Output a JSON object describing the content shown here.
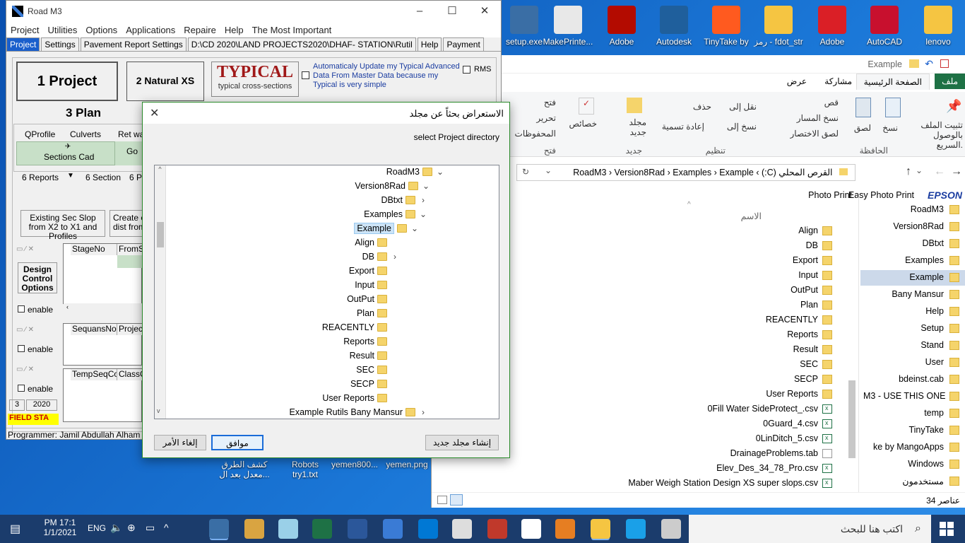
{
  "desktop_icons": [
    {
      "label": "setup.exe",
      "color": "#3a6ea5"
    },
    {
      "label": "MakePrinte...",
      "color": "#e8e8e8"
    },
    {
      "label": "Adobe",
      "color": "#b30b00"
    },
    {
      "label": "Autodesk",
      "color": "#1f5f9c"
    },
    {
      "label": "TinyTake by",
      "color": "#ff5a1f"
    },
    {
      "label": "رمز - fdot_str",
      "color": "#f5c542"
    },
    {
      "label": "Adobe",
      "color": "#da1f26"
    },
    {
      "label": "AutoCAD",
      "color": "#c8102e"
    },
    {
      "label": "lenovo",
      "color": "#f5c542"
    }
  ],
  "desktop_bottom_icons": [
    {
      "label1": "كشف الطرق",
      "label2": "معدل بعد ال..."
    },
    {
      "label1": "Robots",
      "label2": "try1.txt"
    },
    {
      "label1": "yemen800...",
      "label2": ""
    },
    {
      "label1": "yemen.png",
      "label2": ""
    }
  ],
  "road": {
    "title": "Road M3",
    "menu": [
      "Project",
      "Utilities",
      "Options",
      "Applications",
      "Repaire",
      "Help",
      "The Most Important"
    ],
    "tabs": [
      "Project",
      "Settings",
      "Pavement Report Settings",
      "D:\\CD 2020\\LAND PROJECTS2020\\DHAF- STATION\\Rutil",
      "Help",
      "Payment"
    ],
    "btn_project": "1 Project",
    "btn_natural": "2 Natural XS",
    "typical_big": "TYPICAL",
    "typical_small": "typical cross-sections",
    "auto_update": "Automaticaly Update my Typical Advanced Data From Master Data because my Typical is very simple",
    "rms": "RMS",
    "plan": "3 Plan",
    "qprofile": "QProfile",
    "culverts": "Culverts",
    "retwa": "Ret wa",
    "sections_cad": "Sections Cad",
    "go": "Go",
    "reports": "6 Reports",
    "section": "6 Section",
    "sixp": "6 Pl",
    "existing": "Existing Sec Slop from X2 to X1 and Profiles",
    "create": "Create e dist from",
    "design_control": "Design Control Options",
    "enable": "enable",
    "stage_no": "StageNo",
    "from_st": "FromSt",
    "sequans_no": "SequansNo",
    "project_col": "ProjectI",
    "temp_seq": "TempSeqCod",
    "class_co": "ClassCo",
    "num3": "3",
    "year": "2020",
    "field_sta": "FIELD STA",
    "programmer": "Programmer:  Jamil Abdullah Alham"
  },
  "dialog": {
    "title": "الاستعراض بحثاً عن مجلد",
    "subtitle": "select Project directory",
    "tree": [
      {
        "label": "RoadM3",
        "indent": 0,
        "arrow": "⌄"
      },
      {
        "label": "Version8Rad",
        "indent": 1,
        "arrow": "⌄"
      },
      {
        "label": "DBtxt",
        "indent": 2,
        "arrow": "‹"
      },
      {
        "label": "Examples",
        "indent": 2,
        "arrow": "⌄"
      },
      {
        "label": "Example",
        "indent": 3,
        "arrow": "⌄",
        "selected": true
      },
      {
        "label": "Align",
        "indent": 4,
        "arrow": ""
      },
      {
        "label": "DB",
        "indent": 4,
        "arrow": "‹"
      },
      {
        "label": "Export",
        "indent": 4,
        "arrow": ""
      },
      {
        "label": "Input",
        "indent": 4,
        "arrow": ""
      },
      {
        "label": "OutPut",
        "indent": 4,
        "arrow": ""
      },
      {
        "label": "Plan",
        "indent": 4,
        "arrow": ""
      },
      {
        "label": "REACENTLY",
        "indent": 4,
        "arrow": ""
      },
      {
        "label": "Reports",
        "indent": 4,
        "arrow": ""
      },
      {
        "label": "Result",
        "indent": 4,
        "arrow": ""
      },
      {
        "label": "SEC",
        "indent": 4,
        "arrow": ""
      },
      {
        "label": "SECP",
        "indent": 4,
        "arrow": ""
      },
      {
        "label": "User Reports",
        "indent": 4,
        "arrow": ""
      },
      {
        "label": "Example Rutils Bany Mansur",
        "indent": 2,
        "arrow": "‹"
      }
    ],
    "btn_new": "إنشاء مجلد جديد",
    "btn_ok": "موافق",
    "btn_cancel": "إلغاء الأمر"
  },
  "explorer": {
    "title": "Example",
    "tabs": [
      "ملف",
      "الصفحة الرئيسية",
      "مشاركة",
      "عرض"
    ],
    "ribbon": {
      "pin": "تثبيت الملف بالوصول السريع.",
      "copy": "نسخ",
      "paste": "لصق",
      "cut": "قص",
      "copy_path": "نسخ المسار",
      "paste_shortcut": "لصق الاختصار",
      "clipboard": "الحافظة",
      "move_to": "نقل إلى",
      "copy_to": "نسخ إلى",
      "delete": "حذف",
      "rename": "إعادة تسمية",
      "organize": "تنظيم",
      "new_folder": "مجلد جديد",
      "new": "جديد",
      "properties": "خصائص",
      "open": "فتح",
      "edit": "تحرير",
      "history": "المحفوظات",
      "open_group": "فتح"
    },
    "address": [
      "القرص المحلي (C:)",
      "RoadM3",
      "Version8Rad",
      "Examples",
      "Example"
    ],
    "name_header": "الاسم",
    "photo_print": "Photo Print",
    "easy_photo": "Easy Photo Print",
    "epson": "EPSON",
    "files": [
      {
        "name": "Align",
        "type": "folder"
      },
      {
        "name": "DB",
        "type": "folder"
      },
      {
        "name": "Export",
        "type": "folder"
      },
      {
        "name": "Input",
        "type": "folder"
      },
      {
        "name": "OutPut",
        "type": "folder"
      },
      {
        "name": "Plan",
        "type": "folder"
      },
      {
        "name": "REACENTLY",
        "type": "folder"
      },
      {
        "name": "Reports",
        "type": "folder"
      },
      {
        "name": "Result",
        "type": "folder"
      },
      {
        "name": "SEC",
        "type": "folder"
      },
      {
        "name": "SECP",
        "type": "folder"
      },
      {
        "name": "User Reports",
        "type": "folder"
      },
      {
        "name": "0Fill Water SideProtect_.csv",
        "type": "xls"
      },
      {
        "name": "0Guard_4.csv",
        "type": "xls"
      },
      {
        "name": "0LinDitch_5.csv",
        "type": "xls"
      },
      {
        "name": "DrainageProblems.tab",
        "type": "doc"
      },
      {
        "name": "Elev_Des_34_78_Pro.csv",
        "type": "xls"
      },
      {
        "name": "Maber Weigh Station Design XS super slops.csv",
        "type": "xls"
      }
    ],
    "nav": [
      {
        "name": "RoadM3",
        "sel": false
      },
      {
        "name": "Version8Rad",
        "sel": false
      },
      {
        "name": "DBtxt",
        "sel": false
      },
      {
        "name": "Examples",
        "sel": false
      },
      {
        "name": "Example",
        "sel": true
      },
      {
        "name": "Bany Mansur",
        "sel": false
      },
      {
        "name": "Help",
        "sel": false
      },
      {
        "name": "Setup",
        "sel": false
      },
      {
        "name": "Stand",
        "sel": false
      },
      {
        "name": "User",
        "sel": false
      },
      {
        "name": "bdeinst.cab",
        "sel": false
      },
      {
        "name": "M3 - USE THIS ONE",
        "sel": false
      },
      {
        "name": "temp",
        "sel": false
      },
      {
        "name": "TinyTake",
        "sel": false
      },
      {
        "name": "ke by MangoApps",
        "sel": false
      },
      {
        "name": "Windows",
        "sel": false
      },
      {
        "name": "مستخدمون",
        "sel": false
      }
    ],
    "count": "34 عناصر"
  },
  "taskbar": {
    "time": "PM 17:1",
    "date": "1/1/2021",
    "lang": "ENG",
    "search": "اكتب هنا للبحث"
  }
}
